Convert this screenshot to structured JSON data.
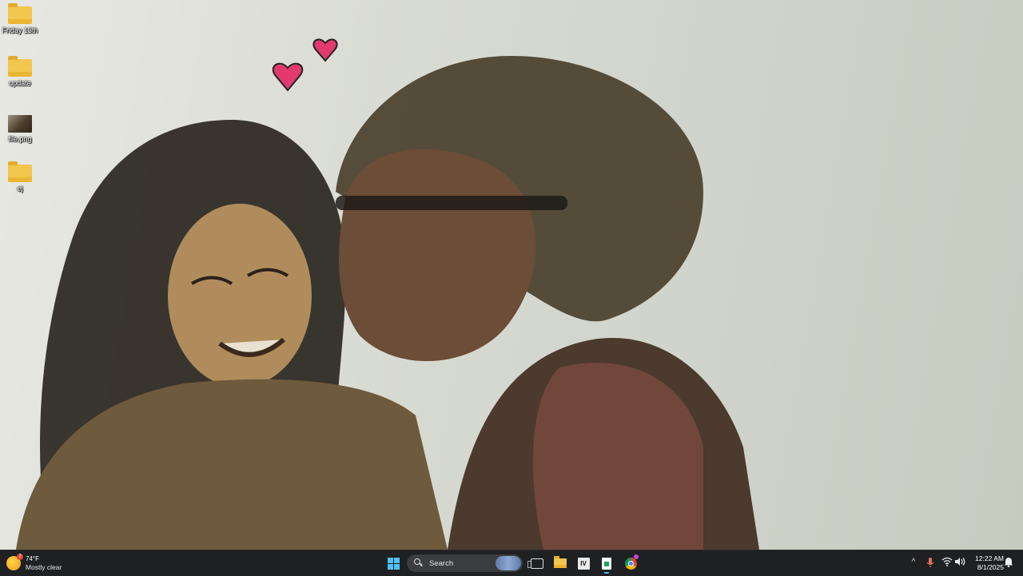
{
  "desktop": {
    "icons": [
      {
        "label": "Friday 13th",
        "kind": "folder-photo"
      },
      {
        "label": "update",
        "kind": "folder"
      },
      {
        "label": "file.png",
        "kind": "image"
      },
      {
        "label": "ej",
        "kind": "folder"
      }
    ]
  },
  "taskbar": {
    "weather": {
      "temp": "74°F",
      "condition": "Mostly clear",
      "badge": "7"
    },
    "search": {
      "label": "Search"
    },
    "apps": [
      {
        "name": "start",
        "icon": "windows-logo-icon"
      },
      {
        "name": "task-view",
        "icon": "task-view-icon"
      },
      {
        "name": "file-explorer",
        "icon": "folder-icon"
      },
      {
        "name": "app-iv",
        "icon": "iv-app-icon",
        "label": "IV"
      },
      {
        "name": "spreadsheet",
        "icon": "sheet-app-icon"
      },
      {
        "name": "chrome",
        "icon": "chrome-icon"
      }
    ],
    "tray": {
      "chevron": "^",
      "time": "12:22 AM",
      "date": "8/1/2025"
    }
  },
  "colors": {
    "taskbar_bg": "#1e2021",
    "accent": "#4cc2ff",
    "folder": "#f3c64e"
  }
}
